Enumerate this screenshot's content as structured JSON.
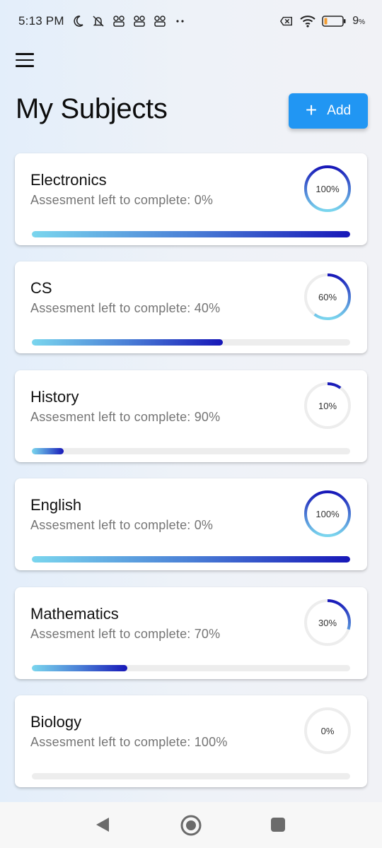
{
  "status_bar": {
    "time": "5:13 PM",
    "battery_percent": "9",
    "battery_unit": "%",
    "icons_left": [
      "moon-icon",
      "bell-muted-icon",
      "app-notification-icon",
      "app-notification-icon",
      "app-notification-icon",
      "more-dots-icon"
    ],
    "icons_right": [
      "no-sim-icon",
      "wifi-icon",
      "battery-low-icon"
    ]
  },
  "header": {
    "title": "My Subjects",
    "add_label": "Add",
    "add_color": "#2196f3"
  },
  "subjects": [
    {
      "name": "Electronics",
      "subtitle": "Assesment left to complete: 0%",
      "progress": 100,
      "progress_label": "100%"
    },
    {
      "name": "CS",
      "subtitle": "Assesment left to complete: 40%",
      "progress": 60,
      "progress_label": "60%"
    },
    {
      "name": "History",
      "subtitle": "Assesment left to complete: 90%",
      "progress": 10,
      "progress_label": "10%"
    },
    {
      "name": "English",
      "subtitle": "Assesment left to complete: 0%",
      "progress": 100,
      "progress_label": "100%"
    },
    {
      "name": "Mathematics",
      "subtitle": "Assesment left to complete: 70%",
      "progress": 30,
      "progress_label": "30%"
    },
    {
      "name": "Biology",
      "subtitle": "Assesment left to complete: 100%",
      "progress": 0,
      "progress_label": "0%"
    }
  ],
  "colors": {
    "progress_start": "#7ad6ee",
    "progress_end": "#1717b8",
    "track": "#ededed"
  }
}
